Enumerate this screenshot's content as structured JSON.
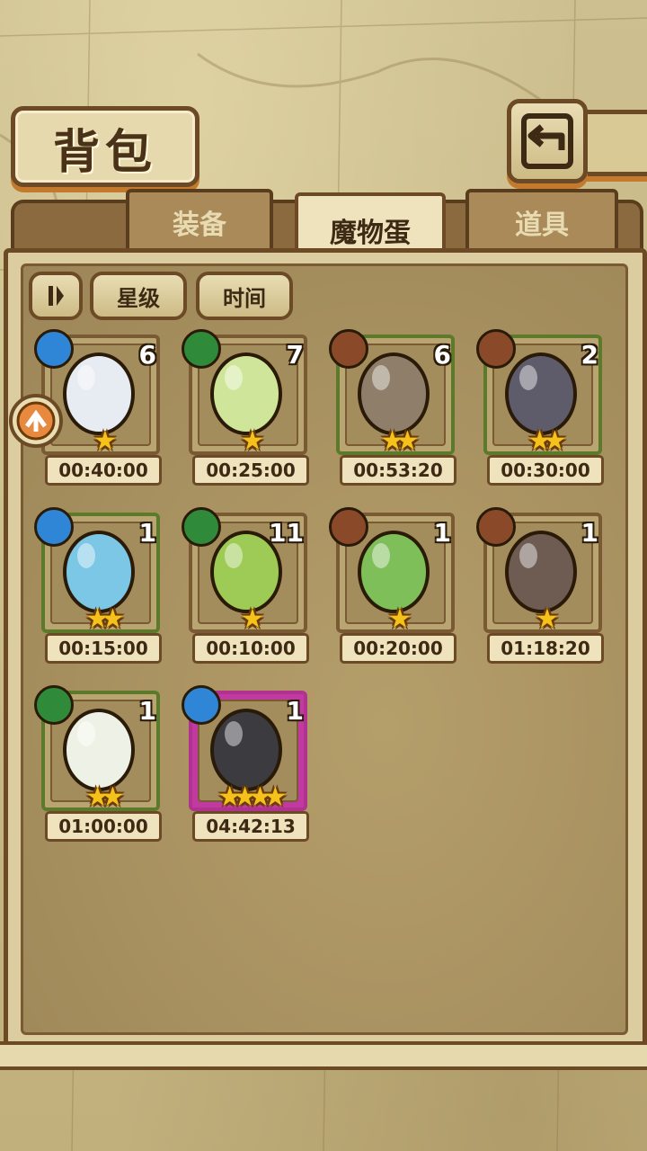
{
  "title": "背包",
  "tabs": [
    {
      "label": "装备",
      "active": false
    },
    {
      "label": "魔物蛋",
      "active": true
    },
    {
      "label": "道具",
      "active": false
    }
  ],
  "sort": {
    "toggle_icon": "pause-sort-icon",
    "star_label": "星级",
    "time_label": "时间"
  },
  "eggs": [
    {
      "element": "water",
      "element_color": "#2f86d6",
      "count": "6",
      "stars": 1,
      "timer": "00:40:00",
      "frame": "plain",
      "egg_color": "#e7ebf2"
    },
    {
      "element": "grass",
      "element_color": "#2f8a3a",
      "count": "7",
      "stars": 1,
      "timer": "00:25:00",
      "frame": "plain",
      "egg_color": "#cfe59a"
    },
    {
      "element": "earth",
      "element_color": "#8a4a2a",
      "count": "6",
      "stars": 2,
      "timer": "00:53:20",
      "frame": "green",
      "egg_color": "#8f7e69"
    },
    {
      "element": "earth",
      "element_color": "#8a4a2a",
      "count": "2",
      "stars": 2,
      "timer": "00:30:00",
      "frame": "green",
      "egg_color": "#5e5b6b"
    },
    {
      "element": "water",
      "element_color": "#2f86d6",
      "count": "1",
      "stars": 2,
      "timer": "00:15:00",
      "frame": "green",
      "egg_color": "#7cc7e6"
    },
    {
      "element": "grass",
      "element_color": "#2f8a3a",
      "count": "11",
      "stars": 1,
      "timer": "00:10:00",
      "frame": "plain",
      "egg_color": "#9ecb55"
    },
    {
      "element": "earth",
      "element_color": "#8a4a2a",
      "count": "1",
      "stars": 1,
      "timer": "00:20:00",
      "frame": "plain",
      "egg_color": "#7fbf59"
    },
    {
      "element": "earth",
      "element_color": "#8a4a2a",
      "count": "1",
      "stars": 1,
      "timer": "01:18:20",
      "frame": "plain",
      "egg_color": "#6e5c52"
    },
    {
      "element": "grass",
      "element_color": "#2f8a3a",
      "count": "1",
      "stars": 2,
      "timer": "01:00:00",
      "frame": "green",
      "egg_color": "#eef2e6"
    },
    {
      "element": "water",
      "element_color": "#2f86d6",
      "count": "1",
      "stars": 4,
      "timer": "04:42:13",
      "frame": "pink",
      "egg_color": "#3b3b40"
    }
  ]
}
